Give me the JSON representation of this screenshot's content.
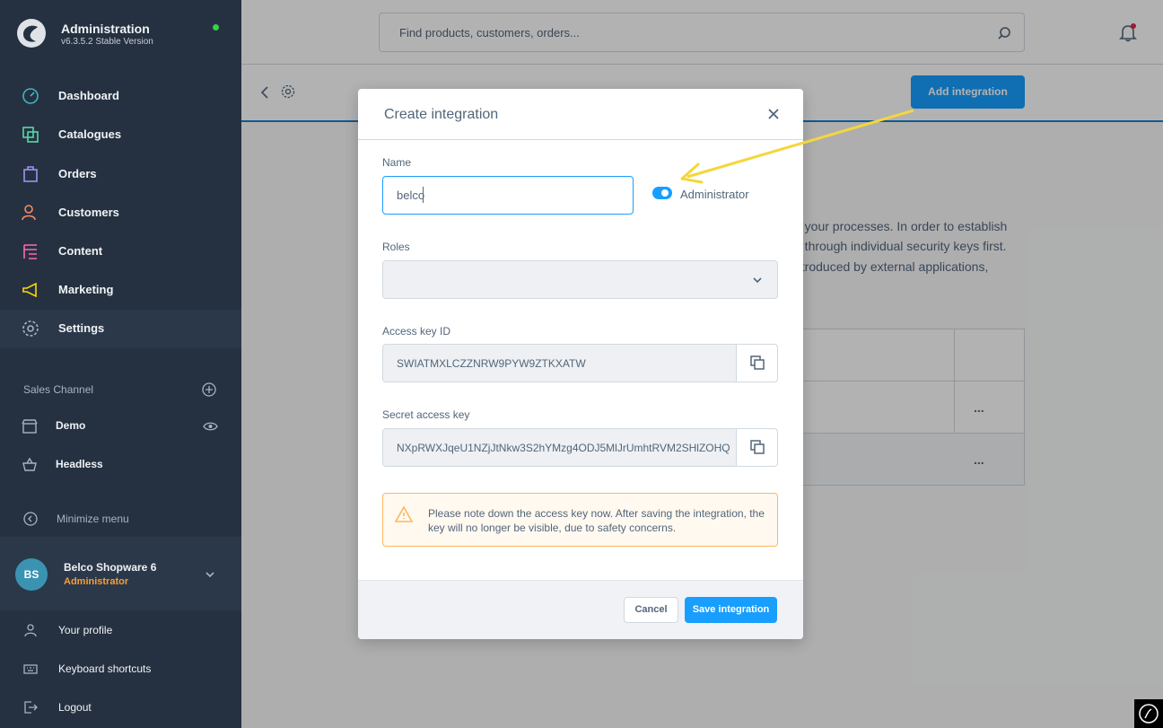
{
  "brand": {
    "title": "Administration",
    "version": "v6.3.5.2 Stable Version",
    "accent": "#189eff"
  },
  "sidebar": {
    "items": [
      {
        "label": "Dashboard",
        "icon": "dashboard-icon"
      },
      {
        "label": "Catalogues",
        "icon": "catalogue-icon"
      },
      {
        "label": "Orders",
        "icon": "orders-icon"
      },
      {
        "label": "Customers",
        "icon": "customers-icon"
      },
      {
        "label": "Content",
        "icon": "content-icon"
      },
      {
        "label": "Marketing",
        "icon": "marketing-icon"
      },
      {
        "label": "Settings",
        "icon": "settings-icon"
      }
    ],
    "sales_channel_title": "Sales Channel",
    "sales_channels": [
      {
        "label": "Demo"
      },
      {
        "label": "Headless"
      }
    ],
    "minimize_label": "Minimize menu",
    "user": {
      "initials": "BS",
      "name": "Belco Shopware 6",
      "role": "Administrator"
    },
    "bottom_items": [
      {
        "label": "Your profile"
      },
      {
        "label": "Keyboard shortcuts"
      },
      {
        "label": "Logout"
      }
    ]
  },
  "topbar": {
    "search_placeholder": "Find products, customers, orders..."
  },
  "smartbar": {
    "add_button": "Add integration"
  },
  "background_text": {
    "line1": "o your processes. In order to establish",
    "line2": "e through individual security keys first.",
    "line3": "ntroduced by external applications,",
    "row_action": "..."
  },
  "modal": {
    "title": "Create integration",
    "name_label": "Name",
    "name_value": "belco",
    "admin_switch_label": "Administrator",
    "admin_switch_on": true,
    "roles_label": "Roles",
    "roles_value": "",
    "access_key_label": "Access key ID",
    "access_key_value": "SWIATMXLCZZNRW9PYW9ZTKXATW",
    "secret_key_label": "Secret access key",
    "secret_key_value": "NXpRWXJqeU1NZjJtNkw3S2hYMzg4ODJ5MlJrUmhtRVM2SHlZOHQ",
    "alert_text": "Please note down the access key now. After saving the integration, the key will no longer be visible, due to safety concerns.",
    "cancel_label": "Cancel",
    "save_label": "Save integration"
  }
}
